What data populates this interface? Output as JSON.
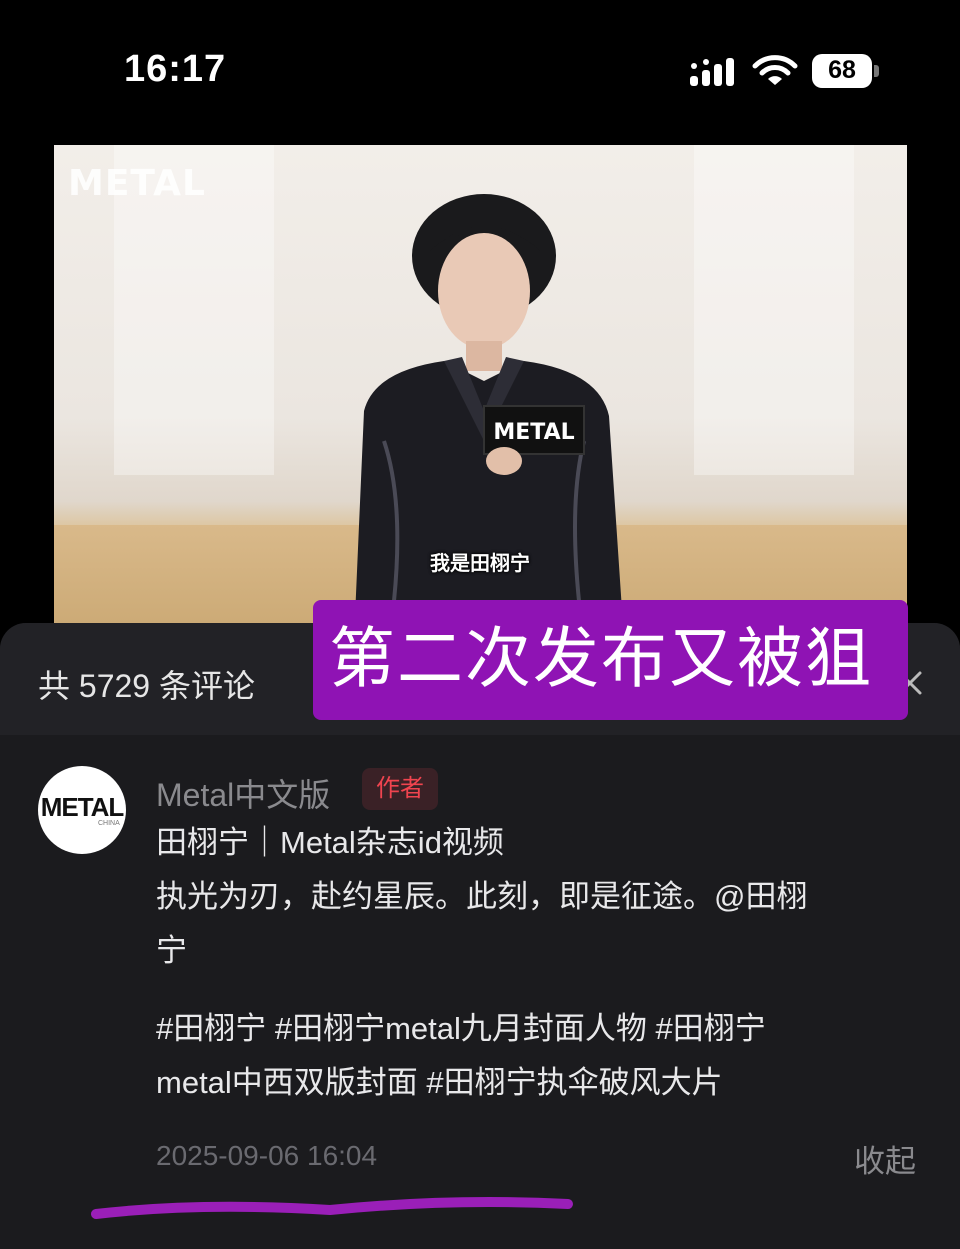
{
  "status_bar": {
    "time": "16:17",
    "battery": "68"
  },
  "video": {
    "logo": "METAL",
    "card_logo": "METAL",
    "subtitle": "我是田栩宁"
  },
  "comments_header": {
    "count_label": "共 5729 条评论"
  },
  "overlay": {
    "banner_text": "第二次发布又被狙",
    "banner_color": "#8f13b4"
  },
  "comment": {
    "avatar_text": "METAL",
    "avatar_sub": "CHINA",
    "author": "Metal中文版",
    "badge": "作者",
    "lines": [
      "田栩宁｜Metal杂志id视频",
      "执光为刃，赴约星辰。此刻，即是征途。@田栩",
      "宁",
      "#田栩宁 #田栩宁metal九月封面人物 #田栩宁",
      "metal中西双版封面 #田栩宁执伞破风大片"
    ],
    "timestamp": "2025-09-06 16:04",
    "collapse_label": "收起"
  },
  "colors": {
    "sheet_bg": "#1b1b1e",
    "badge_text": "#f0444f",
    "annotation": "#9a1fb8"
  }
}
